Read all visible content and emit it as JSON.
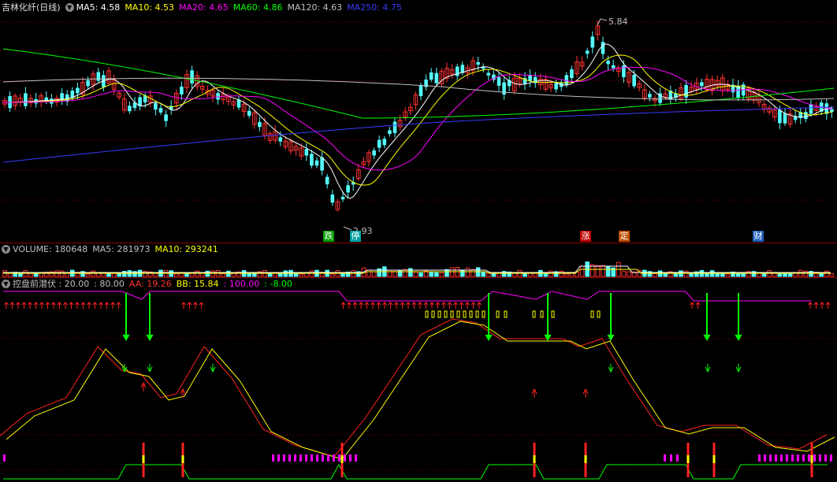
{
  "main_panel": {
    "title": "吉林化纤(日线)",
    "indicators": [
      {
        "label": "MA5: 4.58",
        "color": "#ffffff"
      },
      {
        "label": "MA10: 4.53",
        "color": "#ffff00"
      },
      {
        "label": "MA20: 4.65",
        "color": "#ff00ff"
      },
      {
        "label": "MA60: 4.86",
        "color": "#00ff00"
      },
      {
        "label": "MA120: 4.63",
        "color": "#c0c0c0"
      },
      {
        "label": "MA250: 4.75",
        "color": "#3a3aff"
      }
    ],
    "high_label": "5.84",
    "low_label": "2.93",
    "event_tags": [
      {
        "text": "跌",
        "bg": "#00a000",
        "fg": "#ffffff"
      },
      {
        "text": "停",
        "bg": "#00a0a0",
        "fg": "#ffffff"
      },
      {
        "text": "涨",
        "bg": "#c00000",
        "fg": "#ffffff"
      },
      {
        "text": "定",
        "bg": "#c05000",
        "fg": "#ffffff"
      },
      {
        "text": "财",
        "bg": "#2060c0",
        "fg": "#ffffff"
      }
    ]
  },
  "volume_panel": {
    "indicators": [
      {
        "label": "VOLUME: 180648",
        "color": "#c0c0c0"
      },
      {
        "label": "MA5: 281973",
        "color": "#c0c0c0"
      },
      {
        "label": "MA10: 293241",
        "color": "#ffff00"
      }
    ]
  },
  "indicator_panel": {
    "indicators": [
      {
        "label": "控盘前潜伏 : 20.00",
        "color": "#c0c0c0"
      },
      {
        "label": ": 80.00",
        "color": "#c0c0c0"
      },
      {
        "label": "AA: 19.26",
        "color": "#ff3030"
      },
      {
        "label": "BB: 15.84",
        "color": "#ffff00"
      },
      {
        "label": ": 100.00",
        "color": "#ff00ff"
      },
      {
        "label": ": -8.00",
        "color": "#00ff00"
      }
    ]
  },
  "colors": {
    "up": "#ff3232",
    "down": "#54fcfc",
    "separator": "#8b0000",
    "grid": "#8b0000"
  }
}
